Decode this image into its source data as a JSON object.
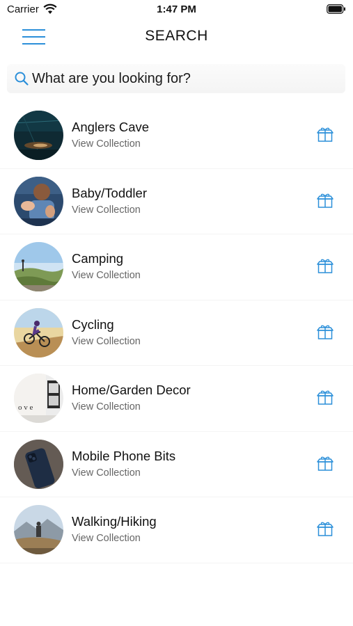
{
  "status_bar": {
    "carrier": "Carrier",
    "time": "1:47 PM"
  },
  "nav": {
    "title": "SEARCH",
    "menu_icon": "hamburger-menu-icon"
  },
  "search": {
    "placeholder": "What are you looking for?",
    "value": "",
    "icon": "search-icon"
  },
  "collections": [
    {
      "title": "Anglers Cave",
      "subtitle": "View Collection",
      "icon": "gift-box-icon"
    },
    {
      "title": "Baby/Toddler",
      "subtitle": "View Collection",
      "icon": "gift-box-icon"
    },
    {
      "title": "Camping",
      "subtitle": "View Collection",
      "icon": "gift-box-icon"
    },
    {
      "title": "Cycling",
      "subtitle": "View Collection",
      "icon": "gift-box-icon"
    },
    {
      "title": "Home/Garden Decor",
      "subtitle": "View Collection",
      "icon": "gift-box-icon"
    },
    {
      "title": "Mobile Phone Bits",
      "subtitle": "View Collection",
      "icon": "gift-box-icon"
    },
    {
      "title": "Walking/Hiking",
      "subtitle": "View Collection",
      "icon": "gift-box-icon"
    }
  ],
  "colors": {
    "accent": "#2b8fd9",
    "text": "#111111",
    "subtext": "#666666"
  }
}
